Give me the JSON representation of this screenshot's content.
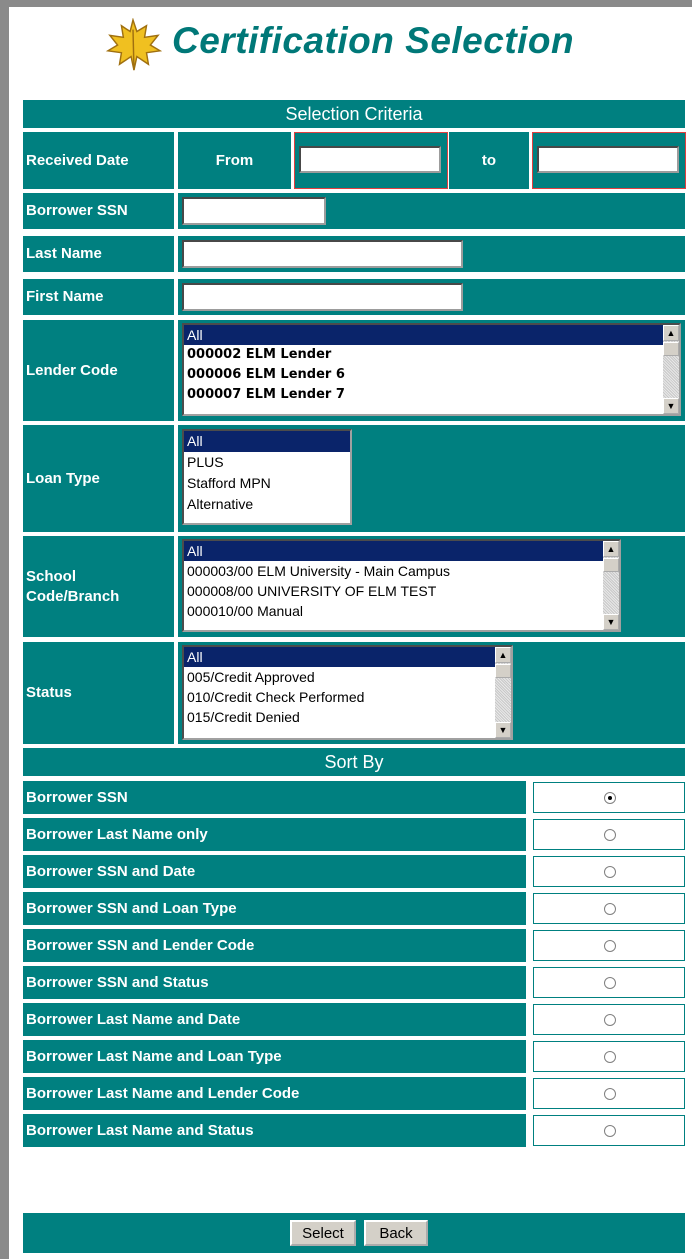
{
  "page_title": "Certification Selection",
  "selection_criteria": {
    "heading": "Selection Criteria",
    "received_date": {
      "label": "Received Date",
      "from_label": "From",
      "to_label": "to",
      "from_value": "",
      "to_value": ""
    },
    "borrower_ssn": {
      "label": "Borrower SSN",
      "value": ""
    },
    "last_name": {
      "label": "Last Name",
      "value": ""
    },
    "first_name": {
      "label": "First Name",
      "value": ""
    },
    "lender_code": {
      "label": "Lender Code",
      "options": [
        "All",
        "000002 ELM Lender",
        "000006 ELM Lender 6",
        "000007 ELM Lender 7"
      ],
      "selected": "All"
    },
    "loan_type": {
      "label": "Loan Type",
      "options": [
        "All",
        "PLUS",
        "Stafford MPN",
        "Alternative"
      ],
      "selected": "All"
    },
    "school_code": {
      "label": "School Code/Branch",
      "options": [
        "All",
        "000003/00 ELM University - Main Campus",
        "000008/00 UNIVERSITY OF ELM TEST",
        "000010/00 Manual"
      ],
      "selected": "All"
    },
    "status": {
      "label": "Status",
      "options": [
        "All",
        "005/Credit Approved",
        "010/Credit Check Performed",
        "015/Credit Denied"
      ],
      "selected": "All"
    }
  },
  "sort_by": {
    "heading": "Sort By",
    "options": [
      "Borrower SSN",
      "Borrower Last Name only",
      "Borrower SSN and Date",
      "Borrower SSN and Loan Type",
      "Borrower SSN and Lender Code",
      "Borrower SSN and Status",
      "Borrower Last Name and Date",
      "Borrower Last Name and Loan Type",
      "Borrower Last Name and Lender Code",
      "Borrower Last Name and Status"
    ],
    "selected": "Borrower SSN"
  },
  "buttons": {
    "select": "Select",
    "back": "Back"
  },
  "colors": {
    "teal": "#008080",
    "title": "#007878",
    "selected_option": "#0a246a"
  }
}
